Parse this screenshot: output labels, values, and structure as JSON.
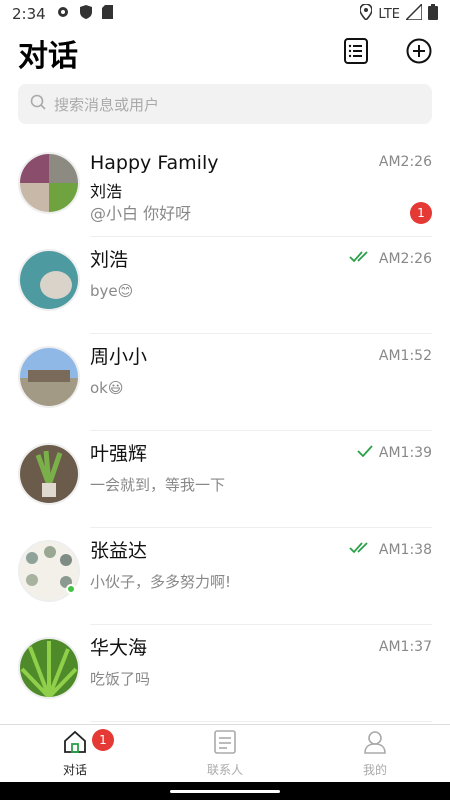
{
  "status": {
    "time": "2:34",
    "network": "LTE"
  },
  "header": {
    "title": "对话"
  },
  "search": {
    "placeholder": "搜索消息或用户"
  },
  "chats": [
    {
      "name": "Happy Family",
      "sender": "刘浩",
      "message": "@小白 你好呀",
      "time": "AM2:26",
      "unread": "1",
      "read": ""
    },
    {
      "name": "刘浩",
      "message": "bye😊",
      "time": "AM2:26",
      "read": "double"
    },
    {
      "name": "周小小",
      "message": "ok😃",
      "time": "AM1:52",
      "read": ""
    },
    {
      "name": "叶强辉",
      "message": "一会就到，等我一下",
      "time": "AM1:39",
      "read": "single"
    },
    {
      "name": "张益达",
      "message": "小伙子，多多努力啊!",
      "time": "AM1:38",
      "read": "double",
      "online": true
    },
    {
      "name": "华大海",
      "message": "吃饭了吗",
      "time": "AM1:37",
      "read": ""
    }
  ],
  "tabs": [
    {
      "label": "对话",
      "badge": "1",
      "active": true
    },
    {
      "label": "联系人",
      "active": false
    },
    {
      "label": "我的",
      "active": false
    }
  ],
  "colors": {
    "accent": "#2aa148",
    "badge": "#e53935"
  }
}
